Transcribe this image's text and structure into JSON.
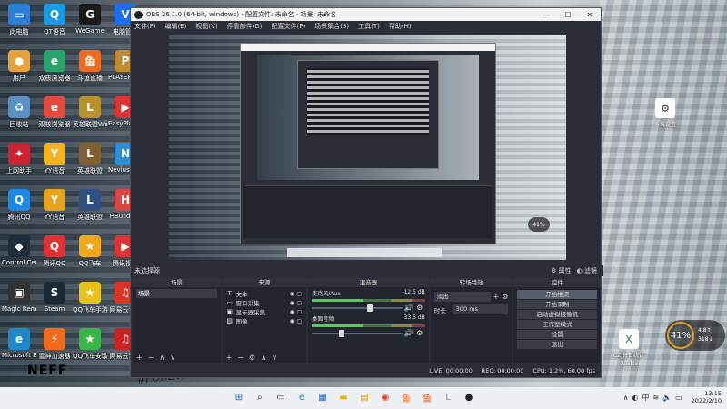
{
  "desktop": {
    "icons": [
      {
        "label": "此电脑",
        "glyph": "▭",
        "color": "#2b7fd6"
      },
      {
        "label": "QT语音",
        "glyph": "Q",
        "color": "#1a9be6"
      },
      {
        "label": "WeGame",
        "glyph": "G",
        "color": "#1b1b1b"
      },
      {
        "label": "电脑管家",
        "glyph": "V",
        "color": "#1d6ff2"
      },
      {
        "label": "用户",
        "glyph": "●",
        "color": "#e8a23a"
      },
      {
        "label": "双核浏览器",
        "glyph": "e",
        "color": "#28a36a"
      },
      {
        "label": "斗鱼直播",
        "glyph": "鱼",
        "color": "#f26a1b"
      },
      {
        "label": "PLAYERUNKNOWN'S BATTLEGROUNDS",
        "glyph": "P",
        "color": "#c28a2e"
      },
      {
        "label": "回收站",
        "glyph": "♻",
        "color": "#5a8fc7"
      },
      {
        "label": "双核浏览器",
        "glyph": "e",
        "color": "#e14b3b"
      },
      {
        "label": "英雄联盟WeGame版",
        "glyph": "L",
        "color": "#b8912c"
      },
      {
        "label": "EasyPlayer",
        "glyph": "▶",
        "color": "#d33"
      },
      {
        "label": "上网助手",
        "glyph": "✦",
        "color": "#c23"
      },
      {
        "label": "YY语音",
        "glyph": "Y",
        "color": "#f2b41a"
      },
      {
        "label": "英雄联盟",
        "glyph": "L",
        "color": "#806030"
      },
      {
        "label": "Nevius Premium",
        "glyph": "N",
        "color": "#2b8fd6"
      },
      {
        "label": "腾讯QQ",
        "glyph": "Q",
        "color": "#1a8ae6"
      },
      {
        "label": "YY语音",
        "glyph": "Y",
        "color": "#e6a31a"
      },
      {
        "label": "英雄联盟",
        "glyph": "L",
        "color": "#305080"
      },
      {
        "label": "HBuilderX",
        "glyph": "H",
        "color": "#d44"
      },
      {
        "label": "Control Center",
        "glyph": "◆",
        "color": "#1f2d3a"
      },
      {
        "label": "腾讯QQ",
        "glyph": "Q",
        "color": "#e03232"
      },
      {
        "label": "QQ飞车",
        "glyph": "★",
        "color": "#f2a81a"
      },
      {
        "label": "腾讯视频",
        "glyph": "▶",
        "color": "#d33"
      },
      {
        "label": "Magic Remote",
        "glyph": "▣",
        "color": "#333"
      },
      {
        "label": "Steam",
        "glyph": "S",
        "color": "#1b2838"
      },
      {
        "label": "QQ飞车手游助手",
        "glyph": "★",
        "color": "#e6c21a"
      },
      {
        "label": "网易云音乐",
        "glyph": "♫",
        "color": "#d32"
      },
      {
        "label": "Microsoft Edge",
        "glyph": "e",
        "color": "#1e88c8"
      },
      {
        "label": "雷神加速器",
        "glyph": "⚡",
        "color": "#f26a1b"
      },
      {
        "label": "QQ飞车安装程序",
        "glyph": "★",
        "color": "#3ab54a"
      },
      {
        "label": "网易云音乐",
        "glyph": "♫",
        "color": "#c22"
      }
    ],
    "right_icons": [
      {
        "label": "系统设置",
        "glyph": "⚙"
      },
      {
        "label": "CZJ每日统计表.xlsx",
        "glyph": "X"
      }
    ],
    "speed": {
      "value": "41",
      "suffix": "%",
      "up": "4.8↑",
      "down": "318↓"
    },
    "brand": "NEFF",
    "hashtag": "#FOREVERYOU"
  },
  "obs": {
    "title": "OBS 26.1.0 (64-bit, windows) - 配置文件: 未命名 - 场景: 未命名",
    "menu": [
      "文件(F)",
      "编辑(E)",
      "视图(V)",
      "停靠部件(D)",
      "配置文件(P)",
      "场景集合(S)",
      "工具(T)",
      "帮助(H)"
    ],
    "current_scene_label": "未选择源",
    "props_button": "属性",
    "filters_button": "滤镜",
    "docks": {
      "scenes": {
        "title": "场景",
        "items": [
          "场景"
        ]
      },
      "sources": {
        "title": "来源",
        "items": [
          {
            "icon": "T",
            "label": "文本"
          },
          {
            "icon": "▭",
            "label": "窗口采集"
          },
          {
            "icon": "▣",
            "label": "显示器采集"
          },
          {
            "icon": "▨",
            "label": "图像"
          }
        ]
      },
      "mixer": {
        "title": "混音器",
        "channels": [
          {
            "name": "麦克风/Aux",
            "db": "-12.5 dB"
          },
          {
            "name": "桌面音频",
            "db": "-33.5 dB"
          }
        ]
      },
      "transitions": {
        "title": "转场特效",
        "type": "淡出",
        "duration_label": "时长",
        "duration_value": "300 ms"
      },
      "controls": {
        "title": "控件",
        "buttons": [
          "开始推流",
          "开始录制",
          "启动虚拟摄像机",
          "工作室模式",
          "设置",
          "退出"
        ]
      }
    },
    "status": {
      "live": "LIVE: 00:00:00",
      "rec": "REC: 00:00:00",
      "cpu": "CPU: 1.2%, 60.00 fps"
    }
  },
  "taskbar": {
    "apps": [
      {
        "name": "start",
        "glyph": "⊞",
        "color": "#1e6fd9"
      },
      {
        "name": "search",
        "glyph": "⌕",
        "color": "#333"
      },
      {
        "name": "taskview",
        "glyph": "▭",
        "color": "#444"
      },
      {
        "name": "edge",
        "glyph": "e",
        "color": "#1e88c8"
      },
      {
        "name": "store",
        "glyph": "▦",
        "color": "#2a6bd1"
      },
      {
        "name": "explorer",
        "glyph": "▬",
        "color": "#e6b422"
      },
      {
        "name": "files",
        "glyph": "▤",
        "color": "#d9a21e"
      },
      {
        "name": "chrome",
        "glyph": "◉",
        "color": "#de4b39"
      },
      {
        "name": "douyu",
        "glyph": "鱼",
        "color": "#f26a1b"
      },
      {
        "name": "douyu2",
        "glyph": "鱼",
        "color": "#e65a1b"
      },
      {
        "name": "league",
        "glyph": "L",
        "color": "#b8912c"
      },
      {
        "name": "obs",
        "glyph": "●",
        "color": "#222"
      }
    ],
    "tray": {
      "time": "13:15",
      "date": "2022/2/10"
    }
  }
}
